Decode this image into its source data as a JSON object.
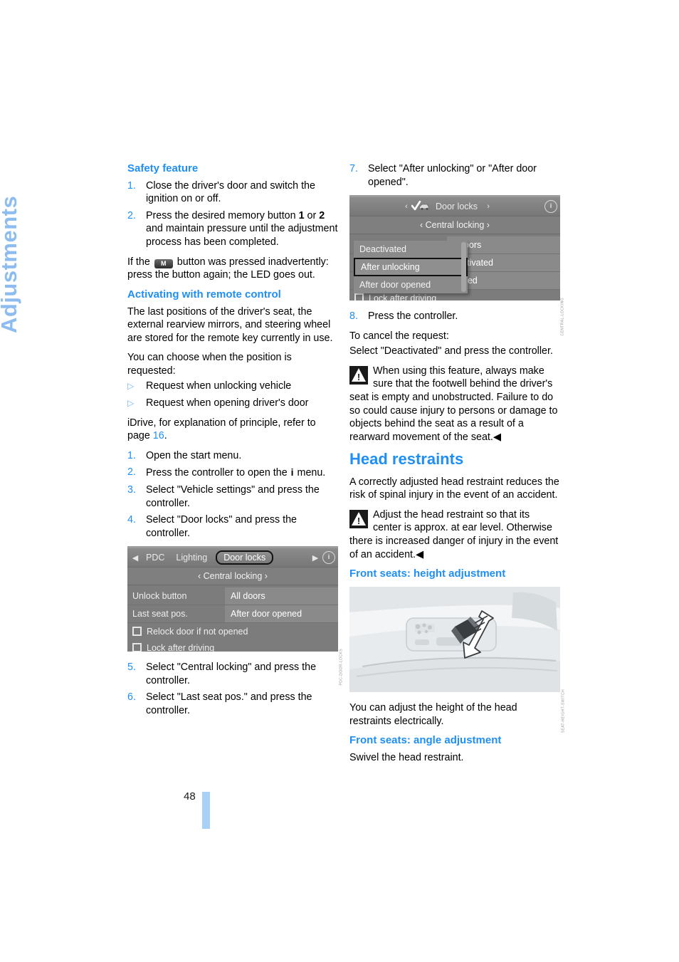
{
  "chapter_tab": "Adjustments",
  "page_number": "48",
  "left_column": {
    "section1_heading": "Safety feature",
    "steps1": [
      {
        "num": "1.",
        "text": "Close the driver's door and switch the ignition on or off."
      },
      {
        "num": "2.",
        "text": "Press the desired memory button 1 or 2 and maintain pressure until the adjustment process has been completed."
      }
    ],
    "m_note_before": "If the",
    "m_key_label": "M",
    "m_note_after": "button was pressed inadvertently: press the button again; the LED goes out.",
    "section2_heading": "Activating with remote control",
    "para1": "The last positions of the driver's seat, the external rearview mirrors, and steering wheel are stored for the remote key currently in use.",
    "para2": "You can choose when the position is requested:",
    "bullets": [
      "Request when unlocking vehicle",
      "Request when opening driver's door"
    ],
    "idrive_ref_before": "iDrive, for explanation of principle, refer to page",
    "idrive_ref_page": "16",
    "idrive_ref_after": ".",
    "steps2": [
      {
        "num": "1.",
        "text": "Open the start menu."
      },
      {
        "num": "2.",
        "text": "Press the controller to open the ı menu."
      },
      {
        "num": "3.",
        "text": "Select \"Vehicle settings\" and press the controller."
      },
      {
        "num": "4.",
        "text": "Select \"Door locks\" and press the controller."
      }
    ],
    "steps2_item2_pre": "Press the controller to open the",
    "steps2_item2_glyph": "i",
    "steps2_item2_post": "menu.",
    "figure1": {
      "arrow_left": "◀",
      "arrow_right": "▶",
      "tabs": [
        "PDC",
        "Lighting",
        "Door locks"
      ],
      "selected_tab": "Door locks",
      "info_icon": "i",
      "subtitle": "‹ Central locking ›",
      "rows": [
        {
          "label": "Unlock button",
          "value": "All doors"
        },
        {
          "label": "Last seat pos.",
          "value": "After door opened"
        }
      ],
      "checkboxes": [
        "Relock door if not opened",
        "Lock after driving"
      ],
      "figcode": "PDC-DOOR-LOCKS"
    },
    "steps3": [
      {
        "num": "5.",
        "text": "Select \"Central locking\" and press the controller."
      },
      {
        "num": "6.",
        "text": "Select \"Last seat pos.\" and press the controller."
      }
    ]
  },
  "right_column": {
    "step7": {
      "num": "7.",
      "text": "Select \"After unlocking\" or \"After door opened\"."
    },
    "figure2": {
      "title": "Door locks",
      "title_arrow_left": "‹",
      "title_arrow_right": "›",
      "car_icon": "check-car-icon",
      "info_icon": "i",
      "subtitle": "‹ Central locking ›",
      "popup_items": [
        {
          "label": "Deactivated",
          "selected": false
        },
        {
          "label": "After unlocking",
          "selected": true
        },
        {
          "label": "After door opened",
          "selected": false
        }
      ],
      "background_rows": [
        "ll doors",
        "eactivated",
        "pened"
      ],
      "checkbox": "Lock after driving",
      "figcode": "CENTRAL-LOCKING"
    },
    "step8": {
      "num": "8.",
      "text": "Press the controller."
    },
    "cancel_line1": "To cancel the request:",
    "cancel_line2": "Select \"Deactivated\" and press the controller.",
    "warning1": "When using this feature, always make sure that the footwell behind the driver's seat is empty and unobstructed. Failure to do so could cause injury to persons or damage to objects behind the seat as a result of a rearward movement of the seat.",
    "warning_end_mark": "◀",
    "major_heading": "Head restraints",
    "para1": "A correctly adjusted head restraint reduces the risk of spinal injury in the event of an accident.",
    "warning2": "Adjust the head restraint so that its center is approx. at ear level. Otherwise there is increased danger of injury in the event of an accident.",
    "section_height": "Front seats: height adjustment",
    "figure3": {
      "figcode": "SEAT-HEIGHT-SWITCH"
    },
    "para_height": "You can adjust the height of the head restraints electrically.",
    "section_angle": "Front seats: angle adjustment",
    "para_angle": "Swivel the head restraint."
  },
  "colors": {
    "accent_blue": "#1f8ef5",
    "tab_blue": "#8dbcf0",
    "page_bar_blue": "#a9d0f5",
    "idrive_gray": "#7c7c7c"
  }
}
